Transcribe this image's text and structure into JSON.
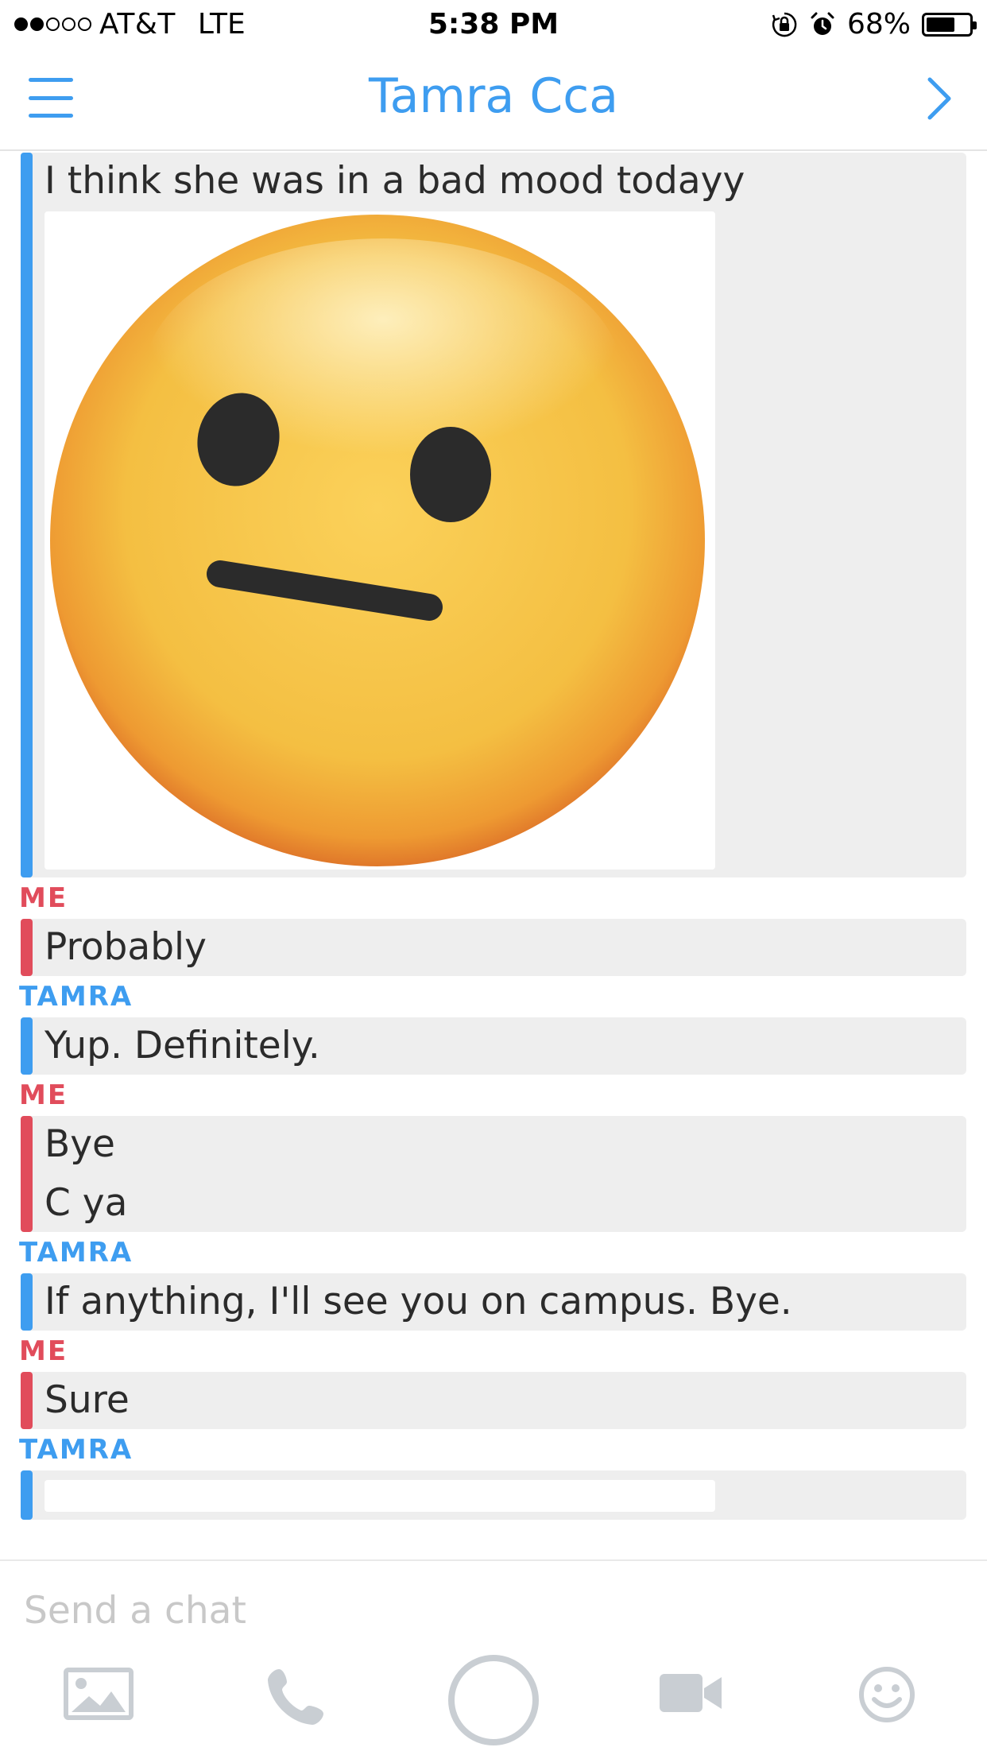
{
  "status_bar": {
    "carrier": "AT&T",
    "network": "LTE",
    "time": "5:38 PM",
    "battery": "68%",
    "battery_level": 0.68,
    "signal_bars_filled": 2,
    "signal_bars_total": 5
  },
  "header": {
    "title": "Tamra Cca",
    "menu_icon": "hamburger-menu-icon",
    "forward_icon": "chevron-right-icon"
  },
  "messages": [
    {
      "sender": "",
      "side": "them",
      "lines": [
        "I think she was in a bad mood todayy"
      ],
      "attachment": "neutral-face-emoji"
    },
    {
      "sender": "ME",
      "side": "me",
      "lines": [
        "Probably"
      ]
    },
    {
      "sender": "TAMRA",
      "side": "them",
      "lines": [
        "Yup. Definitely."
      ]
    },
    {
      "sender": "ME",
      "side": "me",
      "lines": [
        "Bye",
        "C ya"
      ]
    },
    {
      "sender": "TAMRA",
      "side": "them",
      "lines": [
        "If anything, I'll see you on campus. Bye."
      ]
    },
    {
      "sender": "ME",
      "side": "me",
      "lines": [
        "Sure"
      ]
    },
    {
      "sender": "TAMRA",
      "side": "them",
      "lines": [],
      "attachment": "image-partial"
    }
  ],
  "composer": {
    "placeholder": "Send a chat",
    "value": ""
  },
  "toolbar": {
    "icons": [
      "image-icon",
      "phone-icon",
      "capture-button",
      "video-camera-icon",
      "emoji-icon"
    ]
  },
  "colors": {
    "accent_blue": "#3e9df0",
    "me_red": "#e14c5b",
    "bubble_bg": "#eeeeee",
    "icon_gray": "#c9ced3"
  }
}
